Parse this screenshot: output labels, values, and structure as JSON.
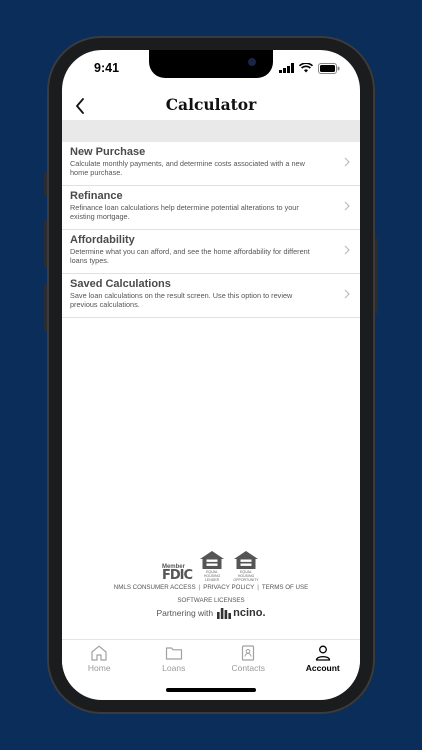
{
  "status": {
    "time": "9:41"
  },
  "header": {
    "title": "Calculator"
  },
  "items": [
    {
      "title": "New Purchase",
      "desc": "Calculate monthly payments, and determine costs associated with a new home purchase."
    },
    {
      "title": "Refinance",
      "desc": "Refinance loan calculations help determine potential alterations to your existing mortgage."
    },
    {
      "title": "Affordability",
      "desc": "Determine what you can afford, and see the home affordability for different loans types."
    },
    {
      "title": "Saved Calculations",
      "desc": "Save loan calculations on the result screen. Use this option to review previous calculations."
    }
  ],
  "footer": {
    "fdic_member": "Member",
    "fdic": "FDIC",
    "ehl_caption": "EQUAL HOUSING LENDER",
    "eho_caption": "EQUAL HOUSING OPPORTUNITY",
    "links": [
      "NMLS CONSUMER ACCESS",
      "PRIVACY POLICY",
      "TERMS OF USE"
    ],
    "software": "SOFTWARE LICENSES",
    "partner": "Partnering with",
    "partner_brand": "ncino."
  },
  "tabs": [
    {
      "label": "Home",
      "icon": "home-icon"
    },
    {
      "label": "Loans",
      "icon": "folder-icon"
    },
    {
      "label": "Contacts",
      "icon": "contact-book-icon"
    },
    {
      "label": "Account",
      "icon": "person-icon",
      "active": true
    }
  ],
  "colors": {
    "background": "#0a2d5a",
    "text": "#4a4a4a",
    "divider": "#e1e1e1"
  }
}
